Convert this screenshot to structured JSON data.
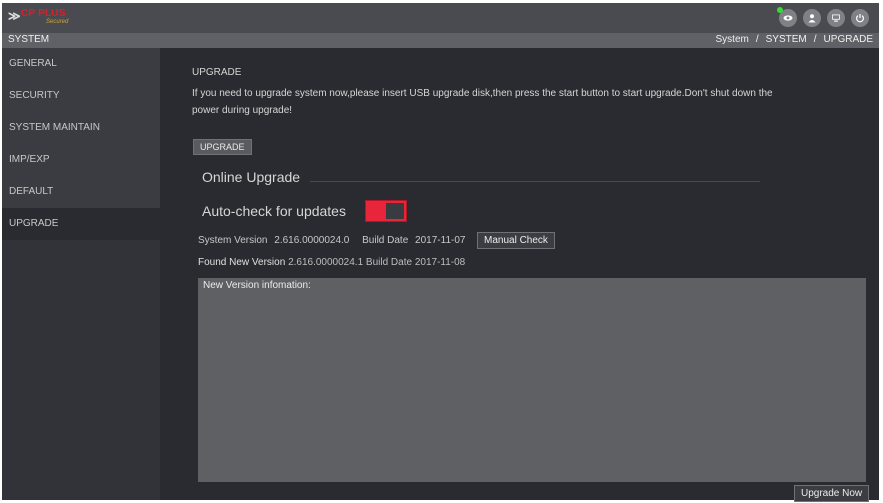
{
  "topbar": {
    "logo_brand": "CP PLUS",
    "logo_sub": "Secured",
    "icons": [
      "eye-icon",
      "user-icon",
      "display-icon",
      "power-icon"
    ]
  },
  "header": {
    "title": "SYSTEM",
    "breadcrumb": [
      "System",
      "SYSTEM",
      "UPGRADE"
    ]
  },
  "sidebar": {
    "items": [
      {
        "label": "GENERAL"
      },
      {
        "label": "SECURITY"
      },
      {
        "label": "SYSTEM MAINTAIN"
      },
      {
        "label": "IMP/EXP"
      },
      {
        "label": "DEFAULT"
      },
      {
        "label": "UPGRADE"
      }
    ]
  },
  "main": {
    "section_title": "UPGRADE",
    "description": "If you need to upgrade system now,please insert USB upgrade disk,then press the start button to start upgrade.Don't shut down the power during upgrade!",
    "upgrade_button": "UPGRADE",
    "online_title": "Online Upgrade",
    "auto_check_label": "Auto-check for updates",
    "auto_check_on": true,
    "system_version_label": "System Version",
    "system_version": "2.616.0000024.0",
    "build_date_label": "Build Date",
    "build_date": "2017-11-07",
    "manual_check_button": "Manual Check",
    "found_label": "Found New Version",
    "found_value": "2.616.0000024.1 Build Date 2017-11-08",
    "info_label": "New Version infomation:",
    "upgrade_now_button": "Upgrade Now"
  },
  "colors": {
    "accent_toggle": "#e8253a",
    "background": "#2a2b30",
    "sidebar": "#3b3c41"
  }
}
